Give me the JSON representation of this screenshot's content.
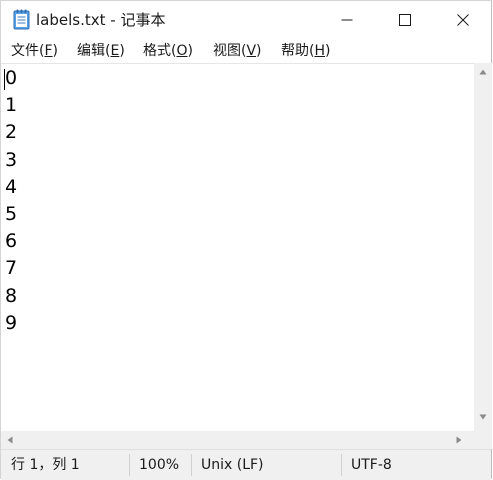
{
  "window": {
    "title": "labels.txt - 记事本",
    "icon": "notepad-icon"
  },
  "controls": {
    "minimize_icon": "minimize-icon",
    "maximize_icon": "maximize-icon",
    "close_icon": "close-icon"
  },
  "menu": [
    {
      "label": "文件(",
      "accel": "F",
      "tail": ")"
    },
    {
      "label": "编辑(",
      "accel": "E",
      "tail": ")"
    },
    {
      "label": "格式(",
      "accel": "O",
      "tail": ")"
    },
    {
      "label": "视图(",
      "accel": "V",
      "tail": ")"
    },
    {
      "label": "帮助(",
      "accel": "H",
      "tail": ")"
    }
  ],
  "editor": {
    "lines": [
      "0",
      "1",
      "2",
      "3",
      "4",
      "5",
      "6",
      "7",
      "8",
      "9"
    ]
  },
  "status": {
    "position": "行 1，列 1",
    "zoom": "100%",
    "line_ending": "Unix (LF)",
    "encoding": "UTF-8"
  }
}
